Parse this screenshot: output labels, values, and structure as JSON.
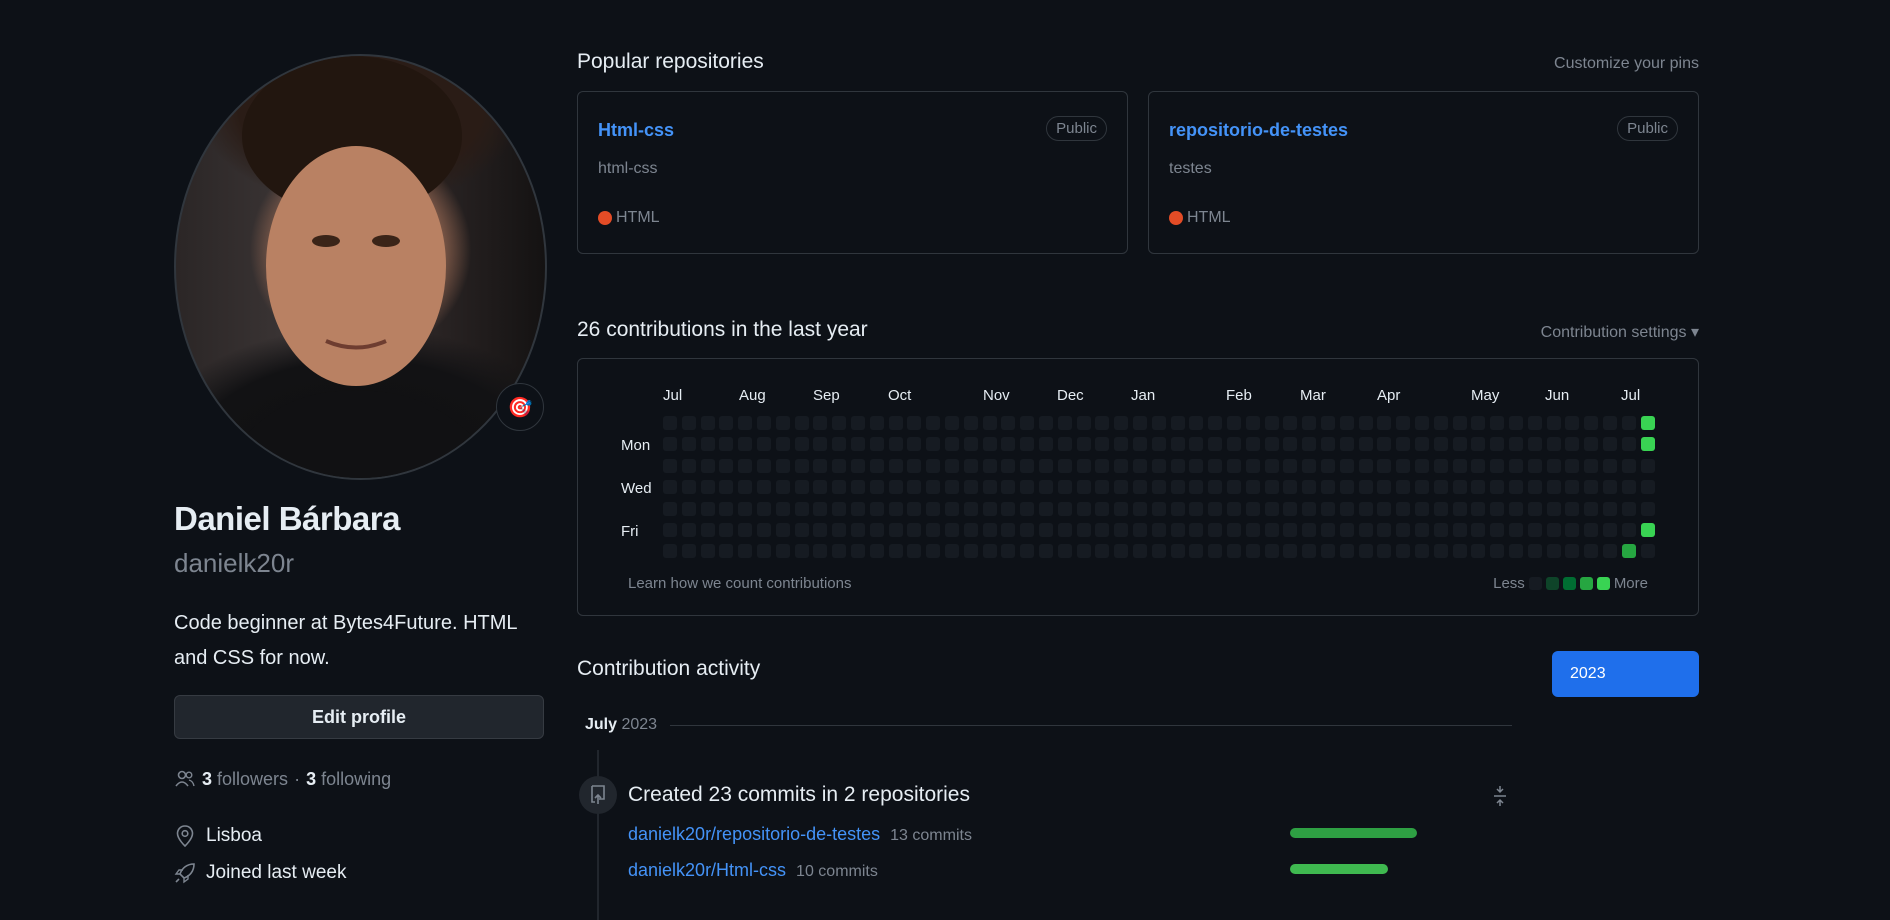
{
  "profile": {
    "name": "Daniel Bárbara",
    "login": "danielk20r",
    "bio": "Code beginner at Bytes4Future. HTML and CSS for now.",
    "edit_label": "Edit profile",
    "followers_count": "3",
    "followers_label": "followers",
    "separator": "·",
    "following_count": "3",
    "following_label": "following",
    "location": "Lisboa",
    "joined": "Joined last week",
    "status_emoji": "🎯"
  },
  "pinned": {
    "title": "Popular repositories",
    "customize_label": "Customize your pins",
    "repos": [
      {
        "name": "Html-css",
        "visibility": "Public",
        "description": "html-css",
        "language": "HTML"
      },
      {
        "name": "repositorio-de-testes",
        "visibility": "Public",
        "description": "testes",
        "language": "HTML"
      }
    ]
  },
  "contributions": {
    "title": "26 contributions in the last year",
    "settings_label": "Contribution settings",
    "months": [
      "Jul",
      "Aug",
      "Sep",
      "Oct",
      "Nov",
      "Dec",
      "Jan",
      "Feb",
      "Mar",
      "Apr",
      "May",
      "Jun",
      "Jul"
    ],
    "days": [
      "Mon",
      "Wed",
      "Fri"
    ],
    "learn_label": "Learn how we count contributions",
    "less_label": "Less",
    "more_label": "More",
    "active_cells": [
      {
        "week": 52,
        "weekday": 0,
        "level": 4
      },
      {
        "week": 52,
        "weekday": 1,
        "level": 4
      },
      {
        "week": 52,
        "weekday": 5,
        "level": 4
      },
      {
        "week": 51,
        "weekday": 6,
        "level": 3
      }
    ],
    "colors": {
      "empty": "#161b22",
      "level1": "#0e4429",
      "level2": "#006d32",
      "level3": "#26a641",
      "level4": "#39d353"
    }
  },
  "activity": {
    "title": "Contribution activity",
    "year_button": "2023",
    "month": "July",
    "year": "2023",
    "summary": "Created 23 commits in 2 repositories",
    "repos": [
      {
        "name": "danielk20r/repositorio-de-testes",
        "commits": "13 commits",
        "value": 13
      },
      {
        "name": "danielk20r/Html-css",
        "commits": "10 commits",
        "value": 10
      }
    ]
  }
}
